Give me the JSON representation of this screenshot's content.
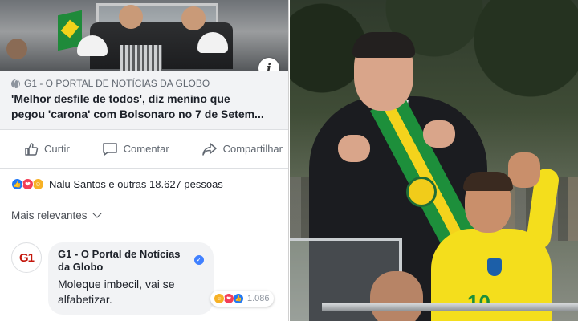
{
  "post": {
    "link_source": "G1 - O PORTAL DE NOTÍCIAS DA GLOBO",
    "headline": "'Melhor desfile de todos', diz menino que\npegou 'carona' com Bolsonaro no 7 de Setem...",
    "info_icon": "i"
  },
  "actions": {
    "like_label": "Curtir",
    "comment_label": "Comentar",
    "share_label": "Compartilhar"
  },
  "reactions": {
    "summary": "Nalu Santos e outras 18.627 pessoas",
    "icons": [
      "like-icon",
      "love-icon",
      "haha-icon"
    ]
  },
  "comments": {
    "sort_label": "Mais relevantes",
    "items": [
      {
        "author": "G1 - O Portal de Notícias da Globo",
        "avatar_text": "G1",
        "text": "Moleque imbecil, vai se alfabetizar.",
        "reaction_count": "1.086"
      }
    ]
  },
  "photo": {
    "shirt_number": "10"
  },
  "colors": {
    "facebook_gray_text": "#606770",
    "link_box_bg": "#f2f3f5",
    "like_blue": "#2078f4",
    "love_red": "#f33e58",
    "haha_yellow": "#f7b125",
    "g1_red": "#c4170c",
    "sash_green": "#1d8f3b",
    "sash_yellow": "#f4d31c"
  }
}
